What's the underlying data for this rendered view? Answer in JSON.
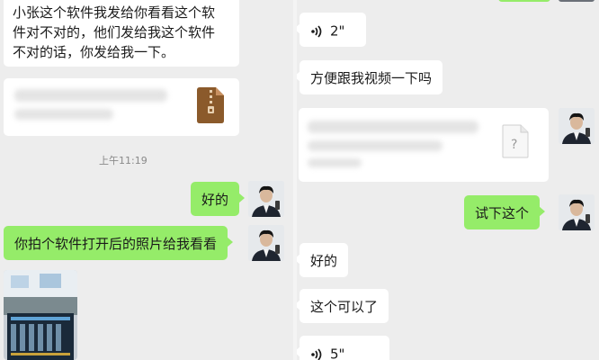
{
  "left_panel": {
    "messages": [
      {
        "text": "小张这个软件我发给你看看这个软件对不对的，他们发给我这个软件不对的话，你发给我一下。"
      },
      {
        "type": "file",
        "icon": "zip-file-icon"
      },
      {
        "timestamp": "上午11:19"
      },
      {
        "text": "好的"
      },
      {
        "text": "你拍个软件打开后的照片给我看看"
      },
      {
        "type": "photo"
      }
    ],
    "line1": "小张这个软件我发给你看看这个软",
    "line2": "件对不对的，他们发给我这个软件",
    "line3": "不对的话，你发给我一下。",
    "timestamp": "上午11:19",
    "reply_ok": "好的",
    "photo_request": "你拍个软件打开后的照片给我看看"
  },
  "right_panel": {
    "voice_1_duration": "2\"",
    "video_request": "方便跟我视频一下吗",
    "unknown_file_icon": "?",
    "try_this": "试下这个",
    "reply_ok": "好的",
    "works_now": "这个可以了",
    "voice_2_duration": "5\""
  },
  "colors": {
    "background": "#ededed",
    "bubble_green": "#95ec69",
    "bubble_white": "#ffffff"
  }
}
